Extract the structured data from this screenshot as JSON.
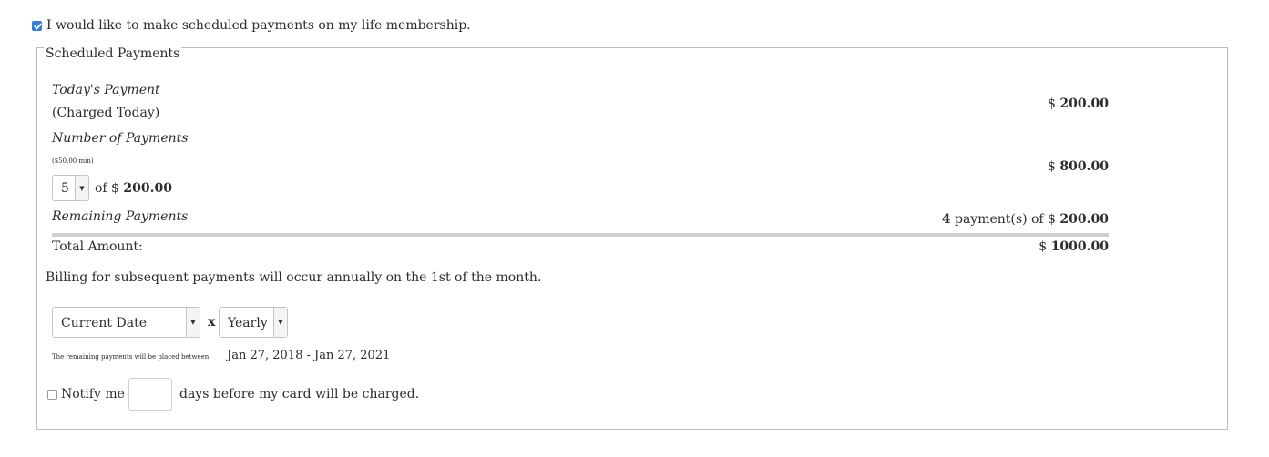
{
  "opt_in": {
    "checked": true,
    "label": "I would like to make scheduled payments on my life membership."
  },
  "fieldset": {
    "legend": "Scheduled Payments"
  },
  "todays_payment": {
    "title": "Today's Payment",
    "subtitle": "(Charged Today)",
    "amount_currency": "$",
    "amount": "200.00"
  },
  "number_of_payments": {
    "title": "Number of Payments",
    "min_note": "($50.00 min)",
    "selected": "5",
    "of_text": "of $",
    "per_amount": "200.00",
    "total_currency": "$",
    "total": "800.00"
  },
  "remaining_payments": {
    "title": "Remaining Payments",
    "count": "4",
    "text": "payment(s) of $",
    "amount": "200.00"
  },
  "total": {
    "label": "Total Amount:",
    "currency": "$",
    "amount": "1000.00"
  },
  "billing_note": "Billing for subsequent payments will occur annually on the 1st of the month.",
  "schedule": {
    "start_select": "Current Date",
    "multiplier": "x",
    "frequency_select": "Yearly",
    "range_note": "The remaining payments will be placed between:",
    "range_value": "Jan 27, 2018 - Jan 27, 2021"
  },
  "notify": {
    "checked": false,
    "label_before": "Notify me",
    "input_value": "",
    "label_after": "days before my card will be charged."
  },
  "colors": {
    "checkbox_checked": "#2f7fe0",
    "border": "#bdbdbd",
    "text": "#2b2b2b"
  }
}
